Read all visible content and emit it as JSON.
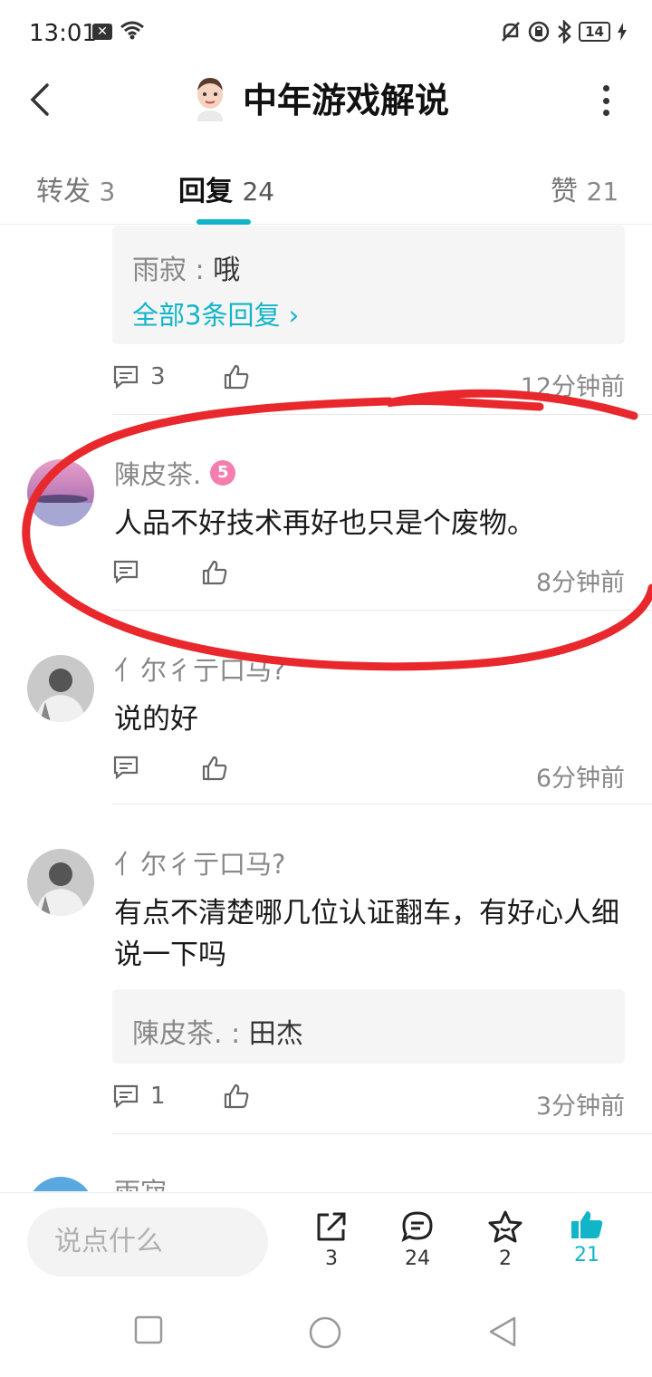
{
  "status_bar": {
    "time": "13:01",
    "battery": "14"
  },
  "header": {
    "title": "中年游戏解说"
  },
  "tabs": [
    {
      "label": "转发",
      "count": "3"
    },
    {
      "label": "回复",
      "count": "24"
    },
    {
      "label": "赞",
      "count": "21"
    }
  ],
  "prev_comment": {
    "reply_user": "雨寂",
    "reply_text": "哦",
    "more_replies": "全部3条回复",
    "reply_count": "3",
    "time": "12分钟前"
  },
  "comments": [
    {
      "user": "陳皮茶.",
      "level": "5",
      "text": "人品不好技术再好也只是个废物。",
      "reply_count": "",
      "time": "8分钟前"
    },
    {
      "user": "亻尔彳亍口马?",
      "text": "说的好",
      "reply_count": "",
      "time": "6分钟前"
    },
    {
      "user": "亻尔彳亍口马?",
      "text": "有点不清楚哪几位认证翻车，有好心人细说一下吗",
      "reply_user": "陳皮茶.",
      "reply_text": "田杰",
      "reply_count": "1",
      "time": "3分钟前"
    },
    {
      "user": "雨寂"
    }
  ],
  "bottom_bar": {
    "input_placeholder": "说点什么",
    "share_count": "3",
    "comment_count": "24",
    "favorite_count": "2",
    "like_count": "21"
  },
  "colors": {
    "accent": "#12b5c8",
    "highlight_circle": "#e8282d"
  }
}
